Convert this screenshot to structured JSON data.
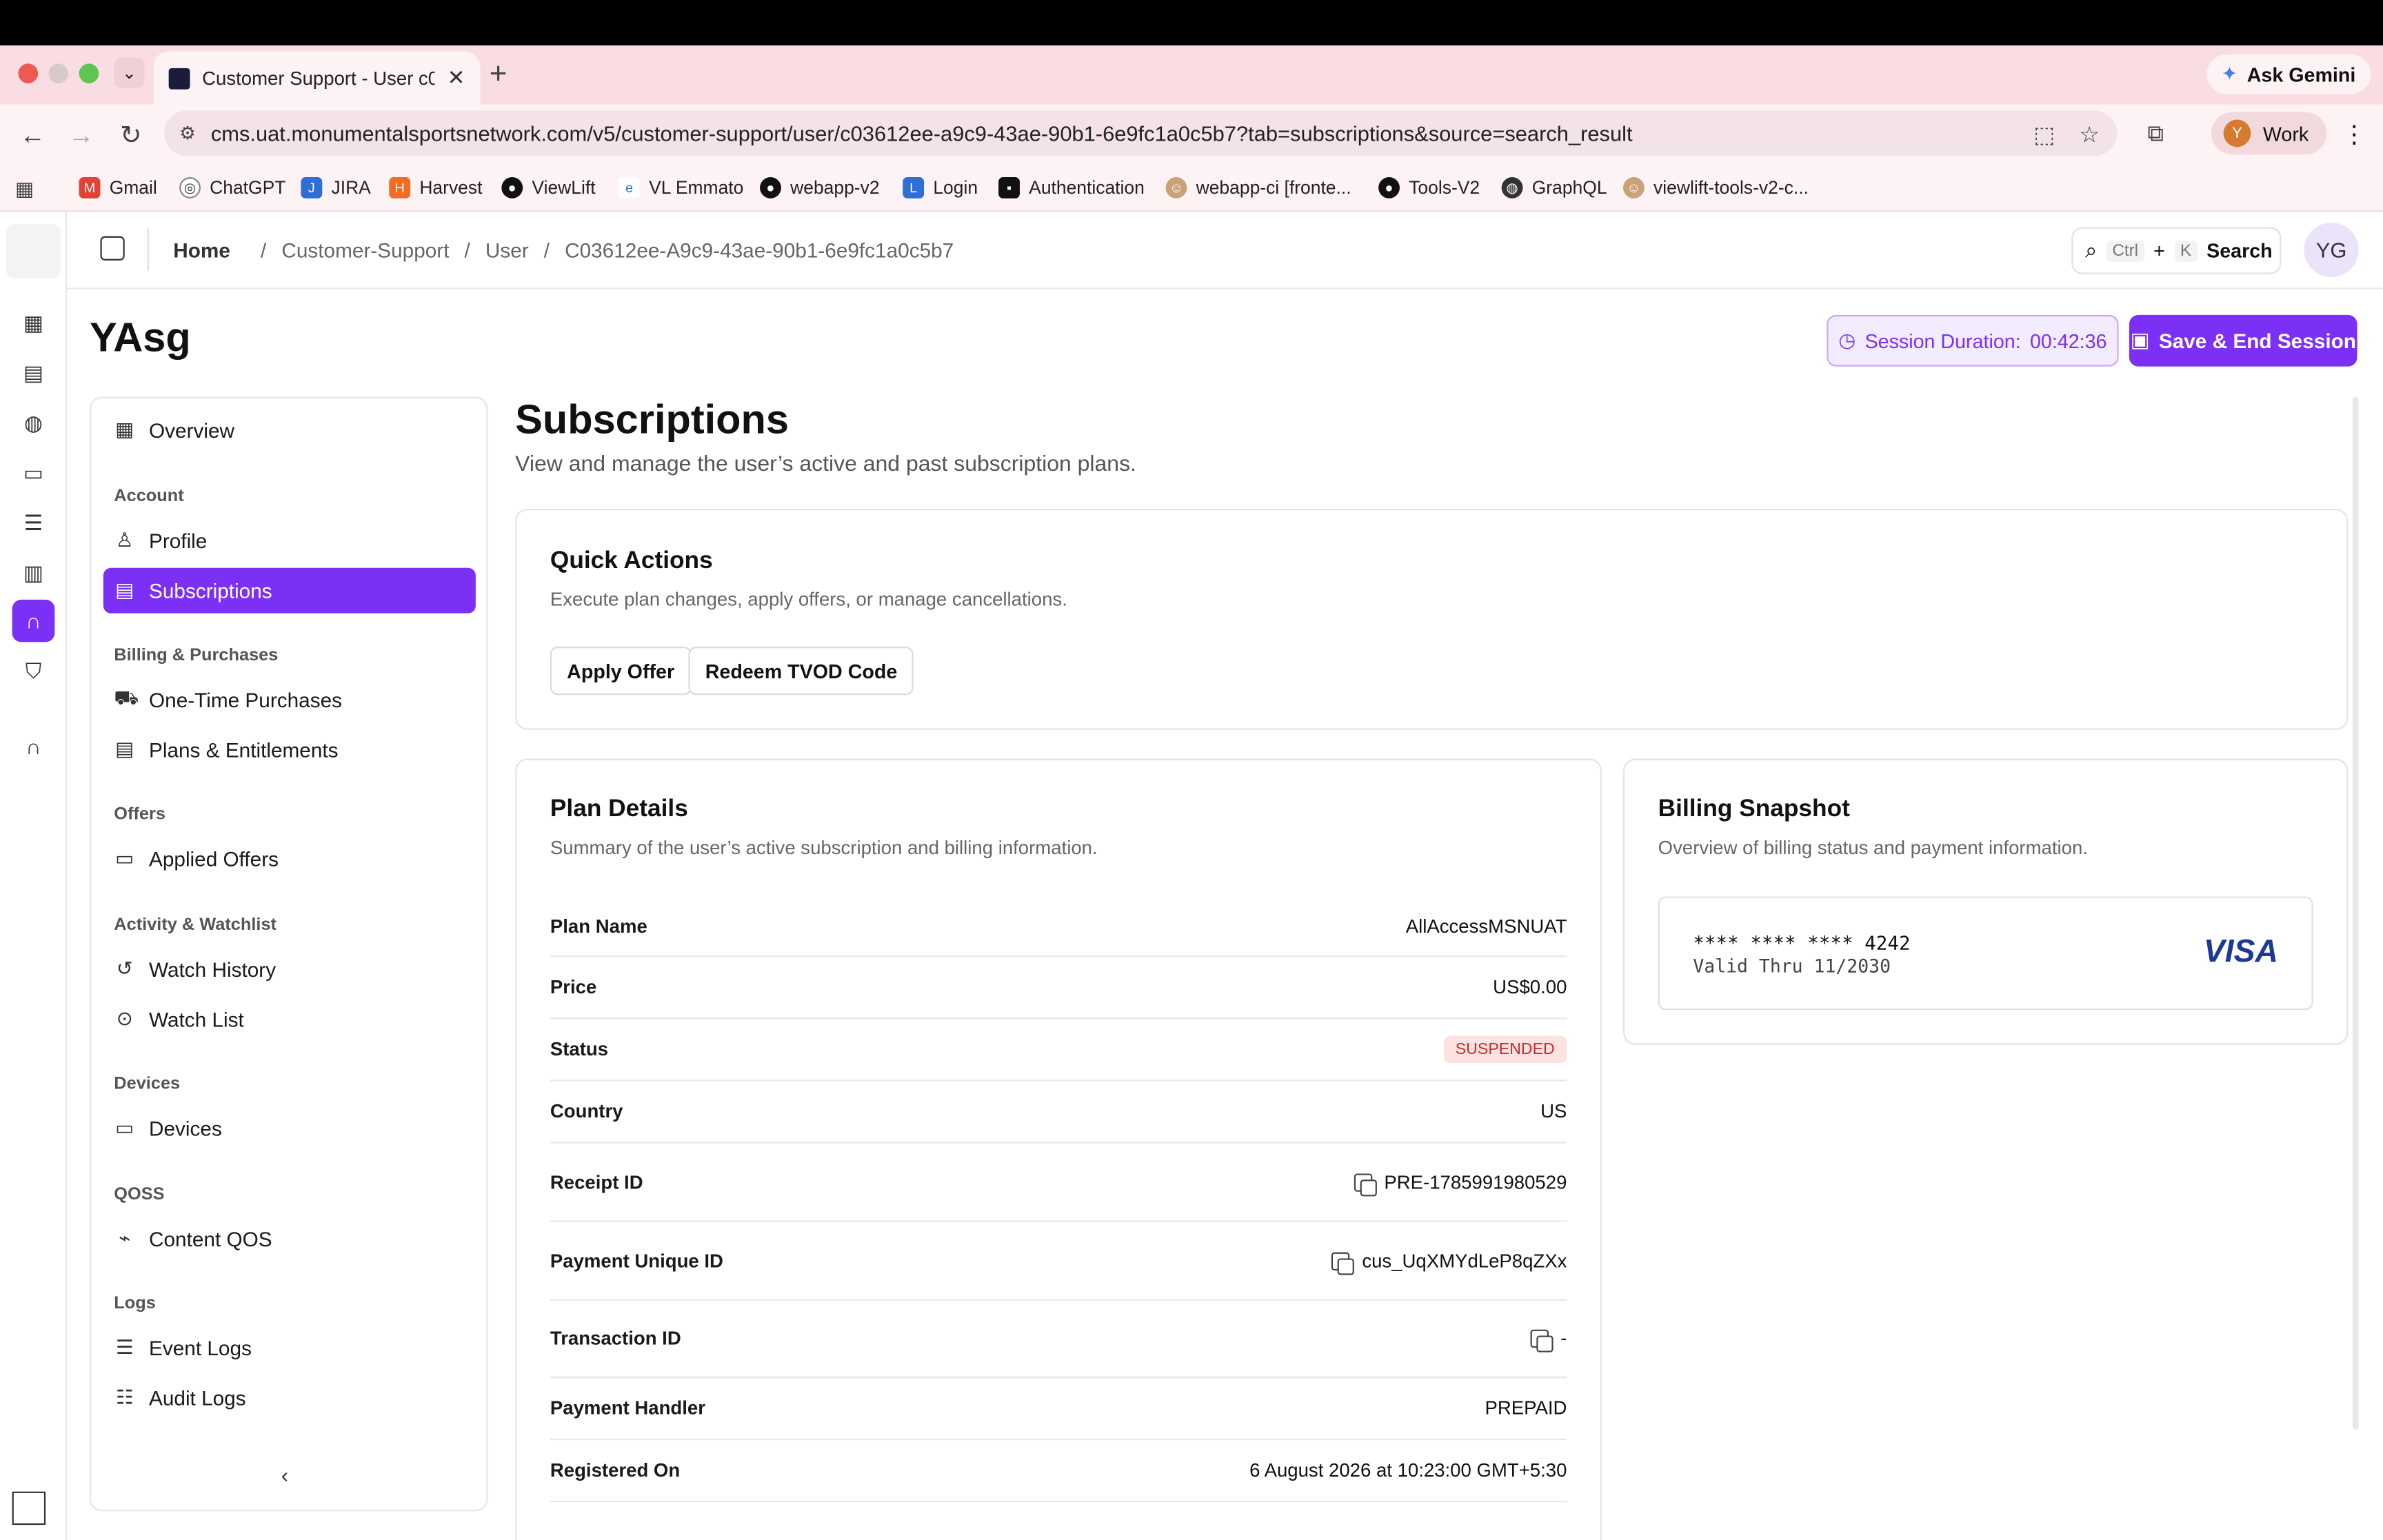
{
  "browser": {
    "tab_title": "Customer Support - User c03",
    "ask_gemini": "Ask Gemini",
    "url": "cms.uat.monumentalsportsnetwork.com/v5/customer-support/user/c03612ee-a9c9-43ae-90b1-6e9fc1a0c5b7?tab=subscriptions&source=search_result",
    "profile_initial": "Y",
    "profile_label": "Work",
    "bookmarks": [
      "Gmail",
      "ChatGPT",
      "JIRA",
      "Harvest",
      "ViewLift",
      "VL Emmato",
      "webapp-v2",
      "Login",
      "Authentication",
      "webapp-ci [fronte...",
      "Tools-V2",
      "GraphQL",
      "viewlift-tools-v2-c..."
    ]
  },
  "header": {
    "breadcrumbs": [
      "Home",
      "/",
      "Customer-Support",
      "/",
      "User",
      "/",
      "C03612ee-A9c9-43ae-90b1-6e9fc1a0c5b7"
    ],
    "search_kbd_ctrl": "Ctrl",
    "search_kbd_plus": "+",
    "search_kbd_k": "K",
    "search_label": "Search",
    "avatar_initials": "YG"
  },
  "page": {
    "title": "YAsg",
    "session_label": "Session Duration:",
    "session_value": "00:42:36",
    "save_label": "Save & End Session"
  },
  "sidenav": {
    "overview": "Overview",
    "groups": {
      "account": "Account",
      "billing": "Billing & Purchases",
      "offers": "Offers",
      "activity": "Activity & Watchlist",
      "devices": "Devices",
      "qoss": "QOSS",
      "logs": "Logs"
    },
    "items": {
      "profile": "Profile",
      "subscriptions": "Subscriptions",
      "one_time": "One-Time Purchases",
      "plans": "Plans & Entitlements",
      "applied_offers": "Applied Offers",
      "watch_history": "Watch History",
      "watch_list": "Watch List",
      "devices": "Devices",
      "content_qos": "Content QOS",
      "event_logs": "Event Logs",
      "audit_logs": "Audit Logs"
    }
  },
  "main": {
    "title": "Subscriptions",
    "subtitle": "View and manage the user’s active and past subscription plans.",
    "quick_actions": {
      "title": "Quick Actions",
      "subtitle": "Execute plan changes, apply offers, or manage cancellations.",
      "apply_offer": "Apply Offer",
      "redeem_tvod": "Redeem TVOD Code"
    },
    "plan_details": {
      "title": "Plan Details",
      "subtitle": "Summary of the user’s active subscription and billing information.",
      "rows": [
        {
          "label": "Plan Name",
          "value": "AllAccessMSNUAT"
        },
        {
          "label": "Price",
          "value": "US$0.00"
        },
        {
          "label": "Status",
          "value": "SUSPENDED"
        },
        {
          "label": "Country",
          "value": "US"
        },
        {
          "label": "Receipt ID",
          "value": "PRE-1785991980529"
        },
        {
          "label": "Payment Unique ID",
          "value": "cus_UqXMYdLeP8qZXx"
        },
        {
          "label": "Transaction ID",
          "value": "-"
        },
        {
          "label": "Payment Handler",
          "value": "PREPAID"
        },
        {
          "label": "Registered On",
          "value": "6 August 2026 at 10:23:00 GMT+5:30"
        }
      ]
    },
    "billing": {
      "title": "Billing Snapshot",
      "subtitle": "Overview of billing status and payment information.",
      "card_number": "**** **** **** 4242",
      "valid_thru": "Valid Thru 11/2030",
      "brand": "VISA"
    }
  },
  "colors": {
    "accent": "#7c2ff5",
    "status_suspended_bg": "#fde2e2",
    "status_suspended_fg": "#c82a2a",
    "visa_blue": "#1a3a93"
  }
}
